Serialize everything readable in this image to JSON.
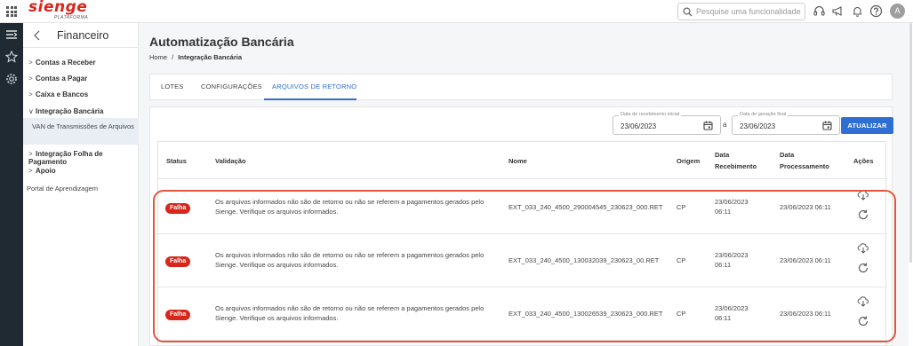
{
  "app": {
    "logo_text": "sienge",
    "logo_sub": "PLATAFORMA",
    "search_placeholder": "Pesquise uma funcionalidade.",
    "avatar_initial": "A"
  },
  "sidebar": {
    "title": "Financeiro",
    "items": [
      {
        "label": "Contas a Receber",
        "chevron": ">"
      },
      {
        "label": "Contas a Pagar",
        "chevron": ">"
      },
      {
        "label": "Caixa e Bancos",
        "chevron": ">"
      },
      {
        "label": "Integração Bancária",
        "chevron": "∨"
      },
      {
        "label": "Integração Folha de Pagamento",
        "chevron": ">"
      },
      {
        "label": "Apoio",
        "chevron": ">"
      }
    ],
    "active_sub": "VAN de Transmissões de Arquivos",
    "portal": "Portal de Aprendizagem"
  },
  "page": {
    "title": "Automatização Bancária",
    "breadcrumb": {
      "home": "Home",
      "sep": "/",
      "current": "Integração Bancária"
    },
    "tabs": [
      {
        "label": "LOTES"
      },
      {
        "label": "CONFIGURAÇÕES"
      },
      {
        "label": "ARQUIVOS DE RETORNO"
      }
    ],
    "active_tab": "ARQUIVOS DE RETORNO"
  },
  "filters": {
    "start": {
      "label": "Data de recebimento inicial",
      "value": "23/06/2023"
    },
    "separator": "a",
    "end": {
      "label": "Data de geração final",
      "value": "23/06/2023"
    },
    "update_button": "ATUALIZAR"
  },
  "table": {
    "headers": {
      "status": "Status",
      "validacao": "Validação",
      "nome": "Nome",
      "origem": "Origem",
      "data_recebimento": "Data\nRecebimento",
      "data_processamento": "Data\nProcessamento",
      "acoes": "Ações"
    },
    "rows": [
      {
        "status": "Falha",
        "validacao": "Os arquivos informados não são de retorno ou não se referem a pagamentos gerados pelo Sienge. Verifique os arquivos informados.",
        "nome": "EXT_033_240_4500_290004545_230623_000.RET",
        "origem": "CP",
        "data_recebimento": "23/06/2023\n06:11",
        "data_processamento": "23/06/2023 06:11"
      },
      {
        "status": "Falha",
        "validacao": "Os arquivos informados não são de retorno ou não se referem a pagamentos gerados pelo Sienge. Verifique os arquivos informados.",
        "nome": "EXT_033_240_4500_130032039_230623_00.RET",
        "origem": "CP",
        "data_recebimento": "23/06/2023\n06:11",
        "data_processamento": "23/06/2023 06:11"
      },
      {
        "status": "Falha",
        "validacao": "Os arquivos informados não são de retorno ou não se referem a pagamentos gerados pelo Sienge. Verifique os arquivos informados.",
        "nome": "EXT_033_240_4500_130026539_230623_000.RET",
        "origem": "CP",
        "data_recebimento": "23/06/2023\n06:11",
        "data_processamento": "23/06/2023 06:11"
      }
    ]
  },
  "colors": {
    "brand_red": "#d9261c",
    "primary_blue": "#2f6fd1",
    "highlight": "#e1563c",
    "rail": "#1f2a33"
  },
  "icons": [
    "apps-grid-icon",
    "search-icon",
    "headset-icon",
    "megaphone-icon",
    "bell-icon",
    "help-icon",
    "menu-collapse-icon",
    "star-icon",
    "gear-icon",
    "chevron-left-icon",
    "calendar-icon",
    "cloud-download-icon",
    "refresh-icon"
  ]
}
